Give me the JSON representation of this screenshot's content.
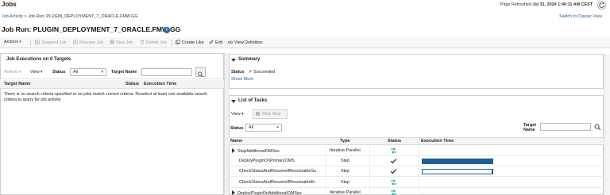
{
  "header": {
    "app_title": "Jobs",
    "refreshed_label": "Page Refreshed",
    "refreshed_value": "Jul 31, 2024 1:40:11 AM CEST",
    "switch_link": "Switch to Classic View"
  },
  "breadcrumb": {
    "link": "Job Activity",
    "separator": ">",
    "current": "Job Run: PLUGIN_DEPLOYMENT_7_ORACLE.FMW.GG"
  },
  "page_title": "Job Run: PLUGIN_DEPLOYMENT_7_ORACLE.FMW.GG",
  "toolbar": {
    "actions": "Actions",
    "suspend": "Suspend Job",
    "resume": "Resume Job",
    "stop": "Stop Job",
    "delete": "Delete Job",
    "create_like": "Create Like",
    "edit": "Edit",
    "view_definition": "View Definition"
  },
  "executions": {
    "title": "Job Executions on 0 Targets",
    "actions": "Actions",
    "view": "View",
    "status_label": "Status",
    "status_value": "All",
    "target_label": "Target Name",
    "columns": [
      "Target Name",
      "Status",
      "Execution Time"
    ],
    "empty_message": "There is no search criteria specified or no jobs match current criteria. Reselect at least one available search criteria to query for job activity"
  },
  "summary": {
    "title": "Summary",
    "status_label": "Status",
    "status_value": "Succeeded",
    "show_more": "Show More"
  },
  "tasks": {
    "title": "List of Tasks",
    "view": "View",
    "stop_step": "Stop Step",
    "status_label": "Status",
    "status_value": "All",
    "target_label_1": "Target",
    "target_label_2": "Name",
    "columns": [
      "Name",
      "Type",
      "Status",
      "Execution Time"
    ],
    "rows": [
      {
        "name": "StopAdditionalOMSes",
        "type": "Iterative Parallel",
        "status_icon": "skipped-arrows-icon",
        "expandable": true,
        "bar": null
      },
      {
        "name": "DeployPluginOnPrimaryOMS",
        "type": "Step",
        "status_icon": "check-icon",
        "expandable": false,
        "bar": {
          "fraction": 0.96,
          "style": "filled"
        }
      },
      {
        "name": "CheckStatusAndResumeIfResumableSu",
        "type": "Step",
        "status_icon": "check-icon",
        "expandable": false,
        "bar": {
          "fraction": 0.96,
          "style": "outline"
        }
      },
      {
        "name": "CheckStatusAndResumeIfResumableEr",
        "type": "Step",
        "status_icon": "skipped-arrows-icon",
        "expandable": false,
        "bar": null
      },
      {
        "name": "DeployPluginOnAdditionalOMSes",
        "type": "Iterative Parallel",
        "status_icon": "skipped-arrows-icon",
        "expandable": true,
        "bar": null
      }
    ]
  },
  "colors": {
    "link": "#1e5a9c",
    "bar_fill": "#1f5e96",
    "skipped_icon": "#2aa198",
    "info_icon": "#1f6bb5"
  }
}
